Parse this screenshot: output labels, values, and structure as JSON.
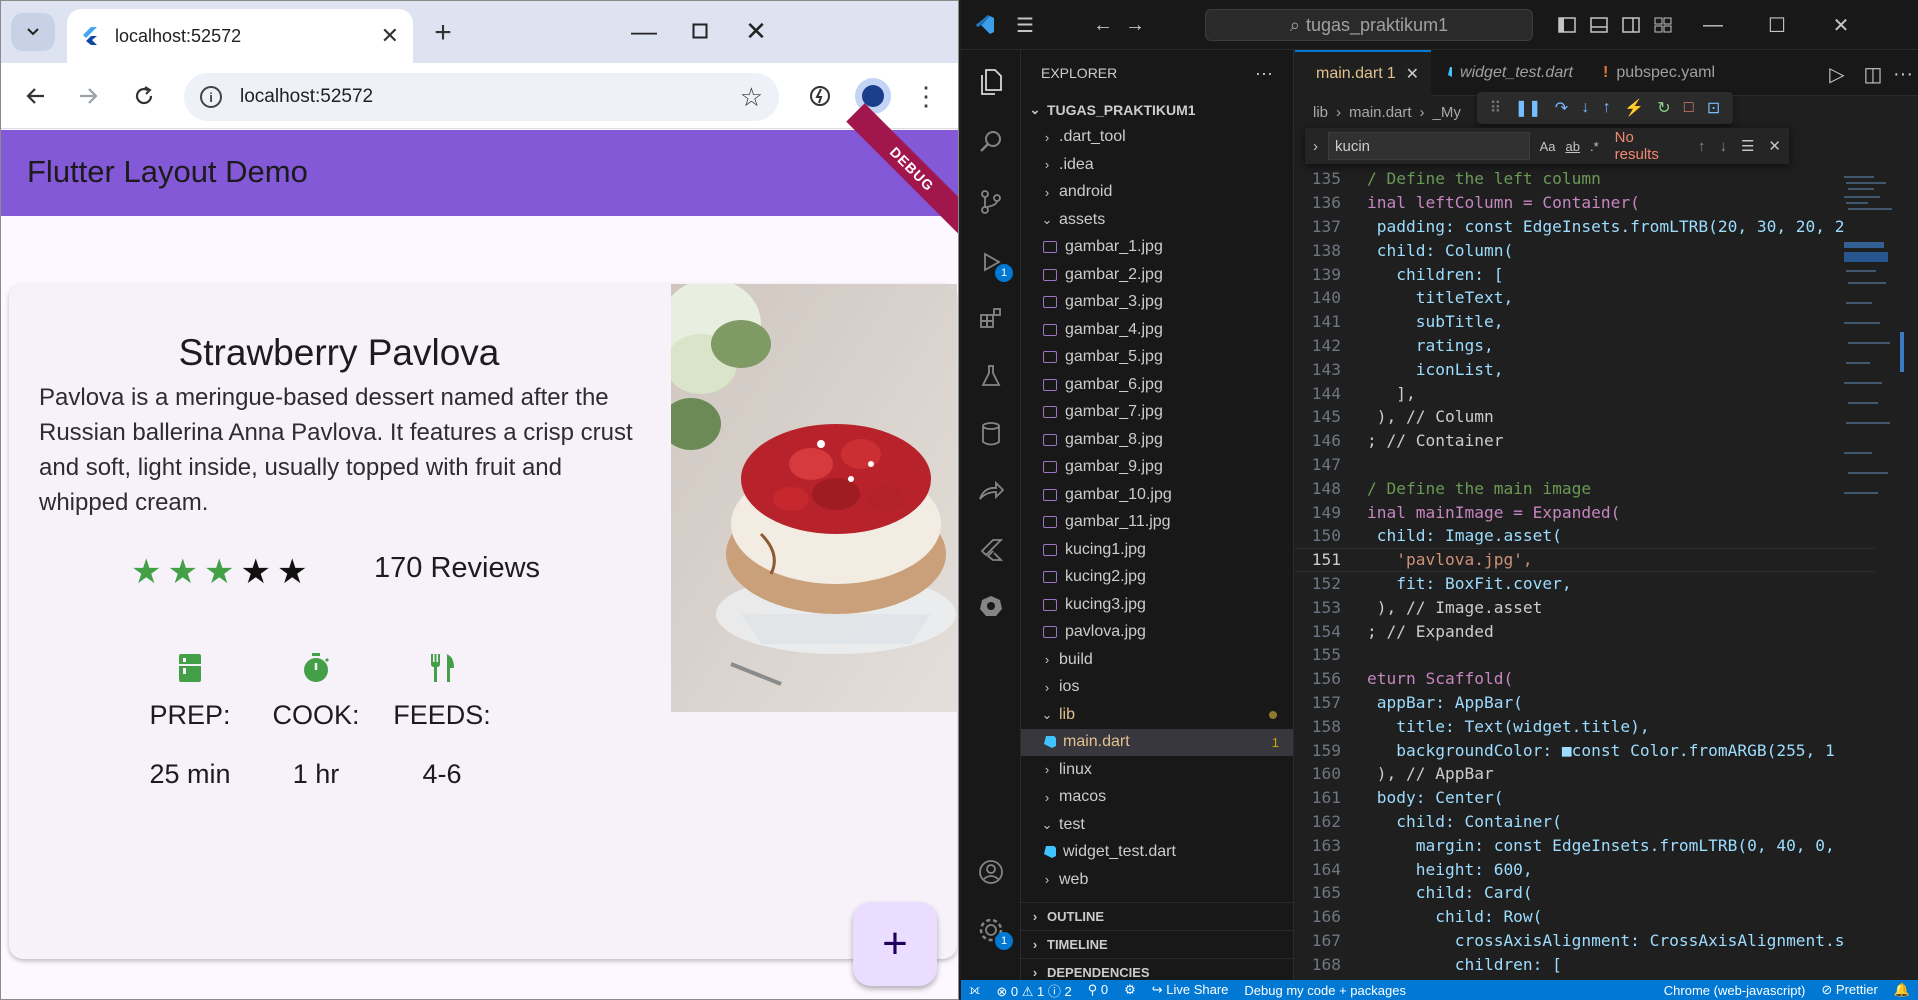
{
  "browser": {
    "tab_title": "localhost:52572",
    "url": "localhost:52572"
  },
  "flutter_app": {
    "appbar_title": "Flutter Layout Demo",
    "debug_banner": "DEBUG",
    "recipe_title": "Strawberry Pavlova",
    "description": "Pavlova is a meringue-based dessert named after the Russian ballerina Anna Pavlova. It features a crisp crust and soft, light inside, usually topped with fruit and whipped cream.",
    "rating": {
      "filled": 3,
      "total": 5
    },
    "reviews": "170 Reviews",
    "info": [
      {
        "icon": "kitchen-icon",
        "label": "PREP:",
        "value": "25 min"
      },
      {
        "icon": "timer-icon",
        "label": "COOK:",
        "value": "1 hr"
      },
      {
        "icon": "restaurant-icon",
        "label": "FEEDS:",
        "value": "4-6"
      }
    ],
    "fab_label": "+"
  },
  "vscode": {
    "command_center": "tugas_praktikum1",
    "explorer_title": "EXPLORER",
    "project_root": "TUGAS_PRAKTIKUM1",
    "tree": [
      {
        "name": ".dart_tool",
        "type": "folder",
        "level": 1,
        "open": false
      },
      {
        "name": ".idea",
        "type": "folder",
        "level": 1,
        "open": false
      },
      {
        "name": "android",
        "type": "folder",
        "level": 1,
        "open": false
      },
      {
        "name": "assets",
        "type": "folder",
        "level": 1,
        "open": true
      },
      {
        "name": "gambar_1.jpg",
        "type": "image",
        "level": 2
      },
      {
        "name": "gambar_2.jpg",
        "type": "image",
        "level": 2
      },
      {
        "name": "gambar_3.jpg",
        "type": "image",
        "level": 2
      },
      {
        "name": "gambar_4.jpg",
        "type": "image",
        "level": 2
      },
      {
        "name": "gambar_5.jpg",
        "type": "image",
        "level": 2
      },
      {
        "name": "gambar_6.jpg",
        "type": "image",
        "level": 2
      },
      {
        "name": "gambar_7.jpg",
        "type": "image",
        "level": 2
      },
      {
        "name": "gambar_8.jpg",
        "type": "image",
        "level": 2
      },
      {
        "name": "gambar_9.jpg",
        "type": "image",
        "level": 2
      },
      {
        "name": "gambar_10.jpg",
        "type": "image",
        "level": 2
      },
      {
        "name": "gambar_11.jpg",
        "type": "image",
        "level": 2
      },
      {
        "name": "kucing1.jpg",
        "type": "image",
        "level": 2
      },
      {
        "name": "kucing2.jpg",
        "type": "image",
        "level": 2
      },
      {
        "name": "kucing3.jpg",
        "type": "image",
        "level": 2
      },
      {
        "name": "pavlova.jpg",
        "type": "image",
        "level": 2
      },
      {
        "name": "build",
        "type": "folder",
        "level": 1,
        "open": false
      },
      {
        "name": "ios",
        "type": "folder",
        "level": 1,
        "open": false
      },
      {
        "name": "lib",
        "type": "folder",
        "level": 1,
        "open": true,
        "modified": true
      },
      {
        "name": "main.dart",
        "type": "dart",
        "level": 2,
        "selected": true,
        "badge": "1"
      },
      {
        "name": "linux",
        "type": "folder",
        "level": 1,
        "open": false
      },
      {
        "name": "macos",
        "type": "folder",
        "level": 1,
        "open": false
      },
      {
        "name": "test",
        "type": "folder",
        "level": 1,
        "open": true
      },
      {
        "name": "widget_test.dart",
        "type": "dart",
        "level": 2
      },
      {
        "name": "web",
        "type": "folder",
        "level": 1,
        "open": false
      }
    ],
    "sections": [
      "OUTLINE",
      "TIMELINE",
      "DEPENDENCIES"
    ],
    "editor_tabs": [
      {
        "label": "main.dart",
        "badge": "1",
        "active": true
      },
      {
        "label": "widget_test.dart",
        "active": false
      },
      {
        "label": "pubspec.yaml",
        "active": false
      }
    ],
    "breadcrumbs": [
      "lib",
      "main.dart",
      "_My"
    ],
    "find": {
      "query": "kucin",
      "result": "No results",
      "options": [
        "Aa",
        "ab",
        ".*"
      ]
    },
    "current_line": 151,
    "code_lines": [
      {
        "n": 135,
        "t": "/ Define the left column"
      },
      {
        "n": 136,
        "t": "inal leftColumn = Container("
      },
      {
        "n": 137,
        "t": " padding: const EdgeInsets.fromLTRB(20, 30, 20, 2"
      },
      {
        "n": 138,
        "t": " child: Column("
      },
      {
        "n": 139,
        "t": "   children: ["
      },
      {
        "n": 140,
        "t": "     titleText,"
      },
      {
        "n": 141,
        "t": "     subTitle,"
      },
      {
        "n": 142,
        "t": "     ratings,"
      },
      {
        "n": 143,
        "t": "     iconList,"
      },
      {
        "n": 144,
        "t": "   ],"
      },
      {
        "n": 145,
        "t": " ), // Column"
      },
      {
        "n": 146,
        "t": "; // Container"
      },
      {
        "n": 147,
        "t": ""
      },
      {
        "n": 148,
        "t": "/ Define the main image"
      },
      {
        "n": 149,
        "t": "inal mainImage = Expanded("
      },
      {
        "n": 150,
        "t": " child: Image.asset("
      },
      {
        "n": 151,
        "t": "   'pavlova.jpg',"
      },
      {
        "n": 152,
        "t": "   fit: BoxFit.cover,"
      },
      {
        "n": 153,
        "t": " ), // Image.asset"
      },
      {
        "n": 154,
        "t": "; // Expanded"
      },
      {
        "n": 155,
        "t": ""
      },
      {
        "n": 156,
        "t": "eturn Scaffold("
      },
      {
        "n": 157,
        "t": " appBar: AppBar("
      },
      {
        "n": 158,
        "t": "   title: Text(widget.title),"
      },
      {
        "n": 159,
        "t": "   backgroundColor: ■const Color.fromARGB(255, 1"
      },
      {
        "n": 160,
        "t": " ), // AppBar"
      },
      {
        "n": 161,
        "t": " body: Center("
      },
      {
        "n": 162,
        "t": "   child: Container("
      },
      {
        "n": 163,
        "t": "     margin: const EdgeInsets.fromLTRB(0, 40, 0, "
      },
      {
        "n": 164,
        "t": "     height: 600,"
      },
      {
        "n": 165,
        "t": "     child: Card("
      },
      {
        "n": 166,
        "t": "       child: Row("
      },
      {
        "n": 167,
        "t": "         crossAxisAlignment: CrossAxisAlignment.s"
      },
      {
        "n": 168,
        "t": "         children: ["
      }
    ],
    "status": {
      "errors": "0",
      "warnings": "1",
      "info": "2",
      "ports": "0",
      "live_share": "Live Share",
      "debug": "Debug my code + packages",
      "target": "Chrome (web-javascript)",
      "prettier": "Prettier"
    }
  },
  "colors": {
    "appbar": "#8459d7",
    "accent_green": "#43a047",
    "vscode_blue": "#0078d4"
  }
}
